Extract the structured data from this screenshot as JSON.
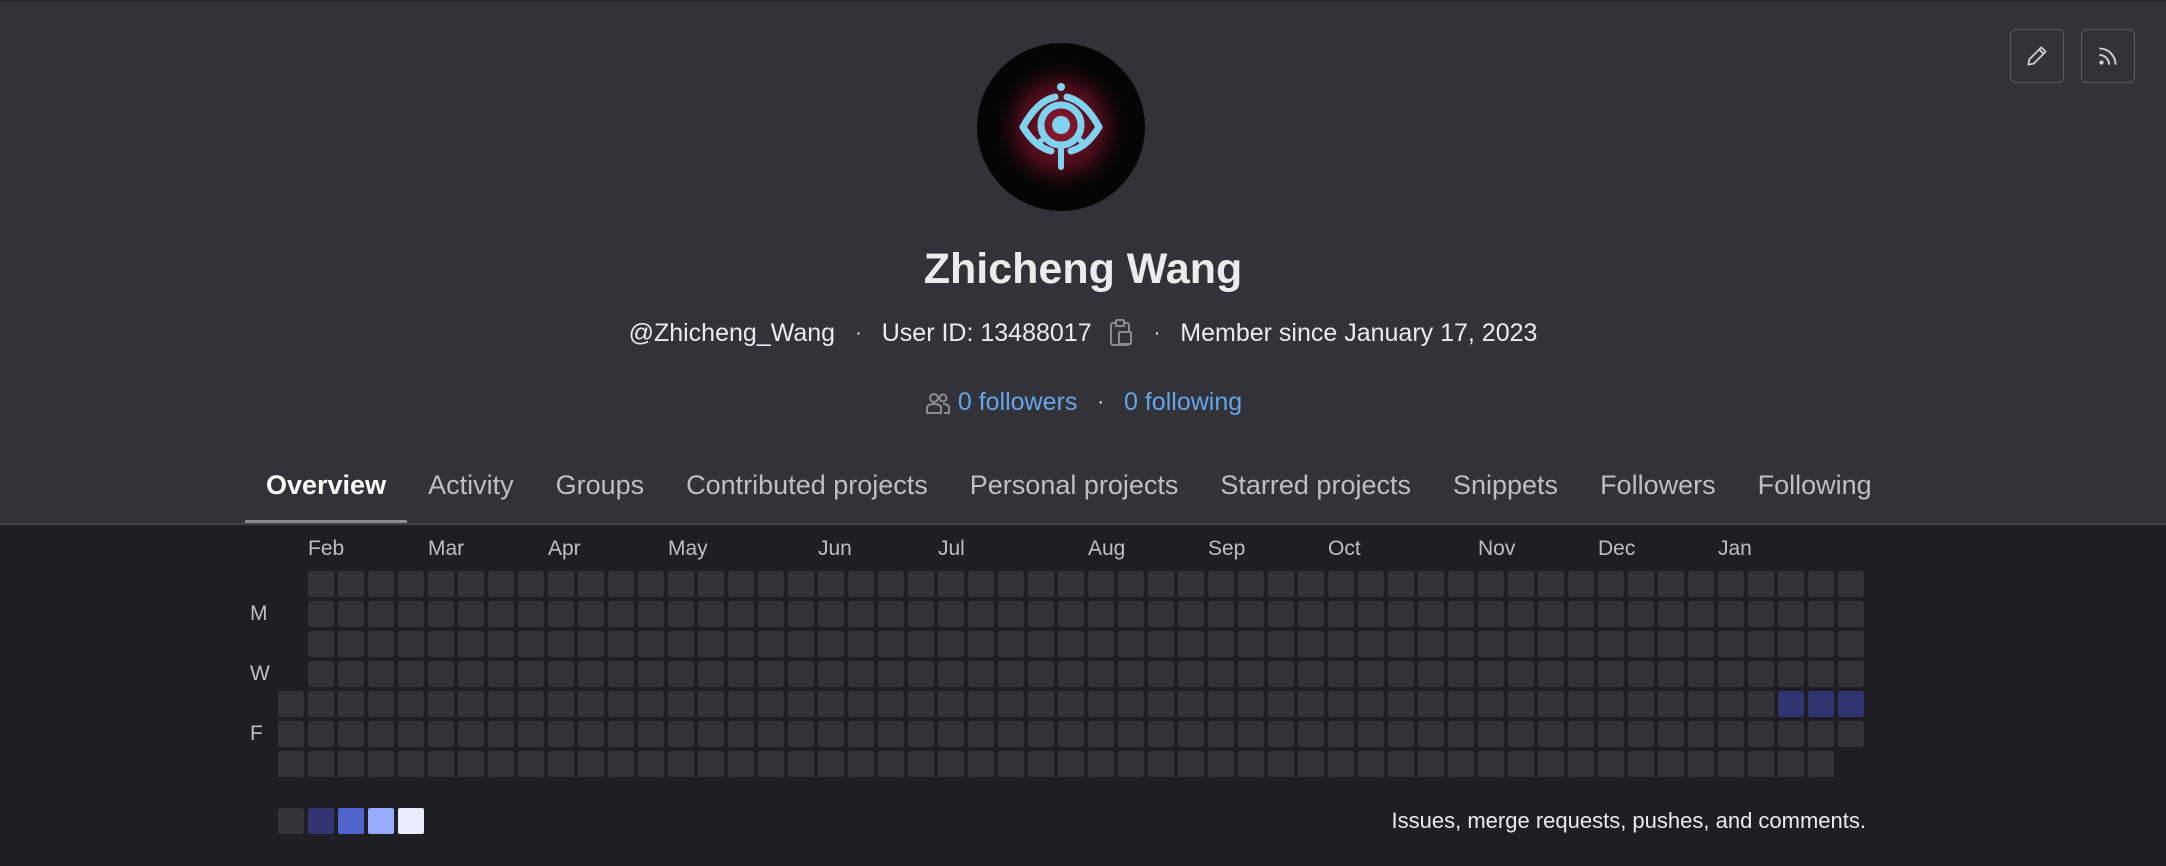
{
  "profile": {
    "name": "Zhicheng Wang",
    "username": "@Zhicheng_Wang",
    "user_id": "User ID: 13488017",
    "member_since": "Member since January 17, 2023",
    "followers": "0 followers",
    "following": "0 following",
    "separator": "·"
  },
  "toolbar": {
    "edit_icon": "pencil-icon",
    "rss_icon": "rss-icon"
  },
  "tabs": [
    {
      "label": "Overview",
      "active": true
    },
    {
      "label": "Activity",
      "active": false
    },
    {
      "label": "Groups",
      "active": false
    },
    {
      "label": "Contributed projects",
      "active": false
    },
    {
      "label": "Personal projects",
      "active": false
    },
    {
      "label": "Starred projects",
      "active": false
    },
    {
      "label": "Snippets",
      "active": false
    },
    {
      "label": "Followers",
      "active": false
    },
    {
      "label": "Following",
      "active": false
    }
  ],
  "calendar": {
    "months": [
      "Feb",
      "Mar",
      "Apr",
      "May",
      "Jun",
      "Jul",
      "Aug",
      "Sep",
      "Oct",
      "Nov",
      "Dec",
      "Jan"
    ],
    "month_start_week": [
      1,
      5,
      9,
      13,
      18,
      22,
      27,
      31,
      35,
      40,
      44,
      48
    ],
    "day_labels": [
      "M",
      "W",
      "F"
    ],
    "day_label_rows": [
      1,
      3,
      5
    ],
    "weeks": 53,
    "first_week_start_row": 4,
    "last_week_end_row": 5,
    "active_cells": [
      {
        "week": 50,
        "row": 4,
        "level": 1
      },
      {
        "week": 51,
        "row": 4,
        "level": 1
      },
      {
        "week": 52,
        "row": 4,
        "level": 1
      }
    ],
    "level_colors": [
      "#333238",
      "#303470",
      "#4e65cd",
      "#97acff",
      "#e9ebff"
    ],
    "caption": "Issues, merge requests, pushes, and comments."
  },
  "colors": {
    "link": "#63a6e9",
    "background": "#333238",
    "calendar_background": "#1f1e24"
  }
}
